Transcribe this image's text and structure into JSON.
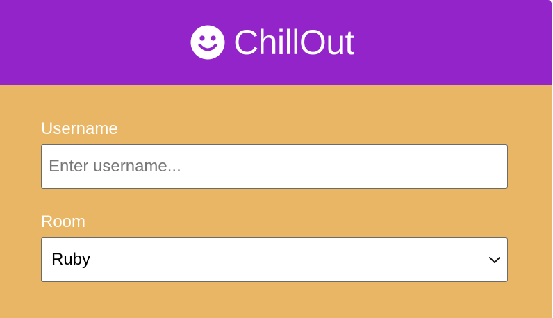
{
  "app": {
    "name": "ChillOut",
    "icon": "smiley-face-icon"
  },
  "colors": {
    "header_bg": "#9324ca",
    "body_bg": "#e9b666",
    "text_on_color": "#ffffff"
  },
  "form": {
    "username": {
      "label": "Username",
      "placeholder": "Enter username...",
      "value": ""
    },
    "room": {
      "label": "Room",
      "selected": "Ruby",
      "icon": "chevron-down-icon"
    }
  }
}
